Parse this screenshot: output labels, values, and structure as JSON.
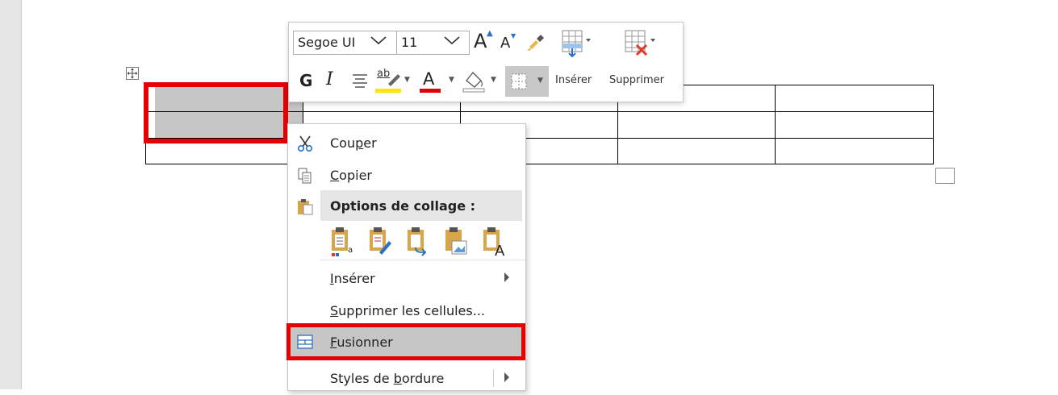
{
  "toolbar": {
    "font_name": "Segoe UI",
    "font_size": "11",
    "grow_font": "A",
    "shrink_font": "A",
    "bold": "G",
    "italic": "I",
    "highlight_glyph": "ab",
    "font_color_glyph": "A",
    "insert_label": "Insérer",
    "delete_label": "Supprimer",
    "colors": {
      "highlight": "#ffe600",
      "font_color": "#e00000",
      "selection_red": "#e60000"
    }
  },
  "context_menu": {
    "cut": {
      "prefix": "Cou",
      "mnemonic": "p",
      "suffix": "er"
    },
    "copy": {
      "prefix": "",
      "mnemonic": "C",
      "suffix": "opier"
    },
    "paste_options": "Options de collage :",
    "insert": {
      "prefix": "",
      "mnemonic": "I",
      "suffix": "nsérer"
    },
    "delete_cells": {
      "prefix": "",
      "mnemonic": "S",
      "suffix": "upprimer les cellules..."
    },
    "merge": {
      "prefix": "",
      "mnemonic": "F",
      "suffix": "usionner"
    },
    "border_styles": {
      "prefix": "Styles de ",
      "mnemonic": "b",
      "suffix": "ordure"
    }
  },
  "icons": [
    "move-table-icon",
    "format-painter-icon",
    "insert-table-icon",
    "delete-table-icon",
    "align-center-icon",
    "shading-icon",
    "borders-icon",
    "scissors-icon",
    "copy-icon",
    "paste-icon",
    "paste-keep-source-icon",
    "paste-merge-icon",
    "paste-text-icon",
    "paste-picture-icon",
    "paste-keep-text-icon",
    "merge-cells-icon",
    "resize-handle-icon"
  ]
}
